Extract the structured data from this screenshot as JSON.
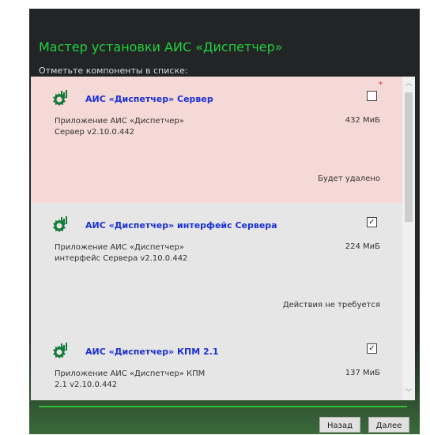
{
  "window": {
    "title": "Мастер установки АИС «Диспетчер»",
    "subtitle": "Отметьте компоненты в списке:"
  },
  "components": [
    {
      "name": "АИС «Диспетчер» Сервер",
      "desc_line1": "Приложение АИС «Диспетчер»",
      "desc_line2": "Сервер v2.10.0.442",
      "size": "432 МиБ",
      "status": "Будет удалено",
      "checked": false,
      "check_mark": "",
      "required_mark": "*",
      "state": "removal"
    },
    {
      "name": "АИС «Диспетчер» интерфейс Сервера",
      "desc_line1": "Приложение АИС «Диспетчер»",
      "desc_line2": "интерфейс Сервера v2.10.0.442",
      "size": "224 МиБ",
      "status": "Действия не требуется",
      "checked": true,
      "check_mark": "✓",
      "state": "none"
    },
    {
      "name": "АИС «Диспетчер» КПМ 2.1",
      "desc_line1": "Приложение АИС «Диспетчер»  КПМ",
      "desc_line2": "2.1 v2.10.0.442",
      "size": "137 МиБ",
      "status": "",
      "checked": true,
      "check_mark": "✓",
      "state": "none"
    }
  ],
  "scrollbar": {
    "up_glyph": "︿",
    "down_glyph": "﹀"
  },
  "buttons": {
    "back_label": "Назад",
    "next_label": "Далее"
  },
  "colors": {
    "title": "#21d13f",
    "removal_bg": "#f5d9d6",
    "item_bg": "#e6e6e6",
    "link": "#1a2fd6",
    "divider": "#2ec033",
    "required": "#e02020"
  },
  "icons": {
    "component": "gear-chart-icon"
  }
}
